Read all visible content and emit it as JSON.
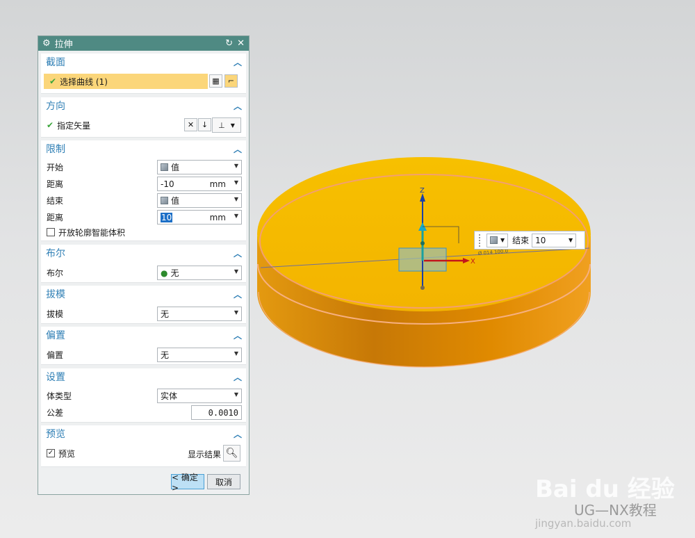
{
  "dialog": {
    "title": "拉伸",
    "icons": {
      "settings": "gear-icon",
      "reset": "reset-icon",
      "close": "close-icon"
    },
    "section_section": {
      "title": "截面",
      "select_curve_label": "选择曲线 (1)"
    },
    "section_direction": {
      "title": "方向",
      "vector_label": "指定矢量"
    },
    "section_limits": {
      "title": "限制",
      "start_label": "开始",
      "start_value": "值",
      "distance1_label": "距离",
      "distance1_value": "-10",
      "distance1_unit": "mm",
      "end_label": "结束",
      "end_value": "值",
      "distance2_label": "距离",
      "distance2_value": "10",
      "distance2_unit": "mm",
      "open_profile_label": "开放轮廓智能体积"
    },
    "section_boolean": {
      "title": "布尔",
      "boolean_label": "布尔",
      "boolean_value": "无"
    },
    "section_draft": {
      "title": "拔模",
      "draft_label": "拔模",
      "draft_value": "无"
    },
    "section_offset": {
      "title": "偏置",
      "offset_label": "偏置",
      "offset_value": "无"
    },
    "section_settings": {
      "title": "设置",
      "body_type_label": "体类型",
      "body_type_value": "实体",
      "tolerance_label": "公差",
      "tolerance_value": "0.0010"
    },
    "section_preview": {
      "title": "预览",
      "preview_label": "预览",
      "preview_checked": true,
      "show_result_label": "显示结果"
    },
    "ok_label": "< 确定 >",
    "cancel_label": "取消"
  },
  "viewport": {
    "axis_z_label": "Z",
    "axis_x_label": "X",
    "float_end_label": "结束",
    "float_end_value": "10",
    "dimension_text": "Ø 014 100.0",
    "colors": {
      "cylinder_top": "#f7c000",
      "cylinder_side": "#e08a00",
      "outline": "#f0a070"
    }
  },
  "watermark": {
    "brand": "Bai du 经验",
    "channel": "UG—NX教程",
    "site": "jingyan.baidu.com"
  }
}
